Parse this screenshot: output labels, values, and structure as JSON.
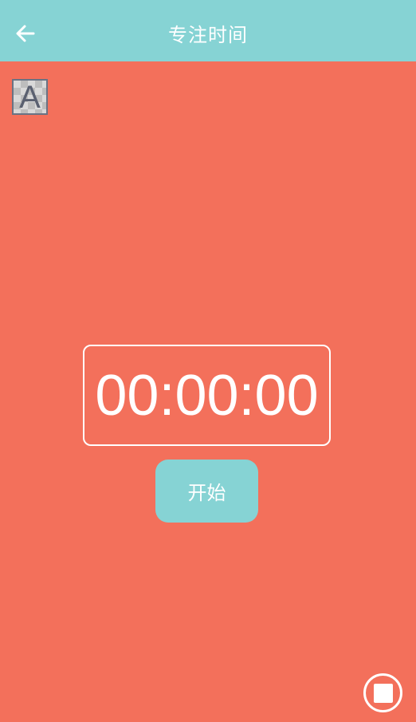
{
  "header": {
    "title": "专注时间",
    "back_icon": "arrow-left-icon",
    "background_color": "#86d3d4"
  },
  "page": {
    "background_color": "#f3705b"
  },
  "placeholder_image": {
    "glyph": "A"
  },
  "timer": {
    "display": "00:00:00"
  },
  "start_button": {
    "label": "开始",
    "color": "#86d3d4"
  },
  "stop_button": {
    "icon": "stop-icon"
  }
}
